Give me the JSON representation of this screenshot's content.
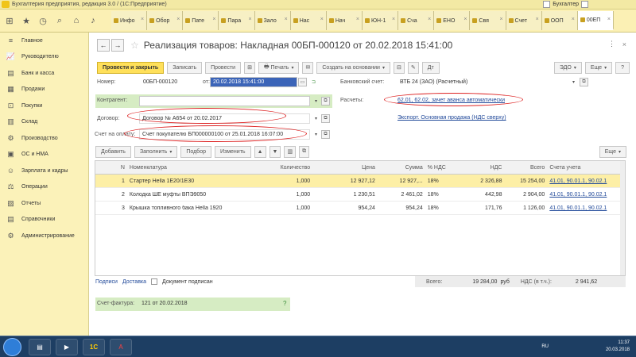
{
  "window": {
    "title": "Бухгалтерия предприятия, редакция 3.0 / (1С:Предприятие)",
    "user": "Бухгалтер"
  },
  "tabs": [
    "Инфо",
    "Обор",
    "Пате",
    "Пара",
    "Зало",
    "Нас",
    "Нач",
    "ЮН-1",
    "Сча",
    "ЕНО",
    "Свя",
    "Счет",
    "ООП",
    "00ЕП"
  ],
  "sidebar": {
    "items": [
      {
        "label": "Главное",
        "icon": "menu-icon"
      },
      {
        "label": "Руководителю",
        "icon": "chart-icon"
      },
      {
        "label": "Банк и касса",
        "icon": "bank-icon"
      },
      {
        "label": "Продажи",
        "icon": "sales-icon"
      },
      {
        "label": "Покупки",
        "icon": "cart-icon"
      },
      {
        "label": "Склад",
        "icon": "warehouse-icon"
      },
      {
        "label": "Производство",
        "icon": "factory-icon"
      },
      {
        "label": "ОС и НМА",
        "icon": "assets-icon"
      },
      {
        "label": "Зарплата и кадры",
        "icon": "staff-icon"
      },
      {
        "label": "Операции",
        "icon": "operations-icon"
      },
      {
        "label": "Отчеты",
        "icon": "reports-icon"
      },
      {
        "label": "Справочники",
        "icon": "reference-icon"
      },
      {
        "label": "Администрирование",
        "icon": "gear-icon"
      }
    ]
  },
  "doc": {
    "title": "Реализация товаров: Накладная 00БП-000120 от 20.02.2018 15:41:00"
  },
  "toolbar": {
    "post_close": "Провести и закрыть",
    "save": "Записать",
    "post": "Провести",
    "print": "Печать",
    "create_based": "Создать на основании",
    "dt_kt": "Дт",
    "edo": "ЭДО",
    "more": "Еще",
    "help": "?"
  },
  "form": {
    "number_label": "Номер:",
    "number_value": "00БП-000120",
    "date_label": "от:",
    "date_value": "20.02.2018 15:41:00",
    "bank_label": "Банковский счет:",
    "bank_value": "ВТБ 24 (ЗАО) (Расчетный)",
    "counterparty_label": "Контрагент:",
    "counterparty_value": "",
    "contract_label": "Договор:",
    "contract_value": "Договор № А654 от 20.02.2017",
    "payment_label": "Счет на оплату:",
    "payment_value": "Счет покупателю БП000000100 от 25.01.2018 16:07:00",
    "settlements_label": "Расчеты:",
    "settlements_value": "62.01, 62.02, зачет аванса автоматически",
    "vat_link": "Экспорт. Основная продажа (НДС сверху)"
  },
  "table": {
    "add": "Добавить",
    "fill": "Заполнить",
    "select": "Подбор",
    "change": "Изменить",
    "more": "Еще",
    "columns": [
      "N",
      "Номенклатура",
      "Количество",
      "Цена",
      "Сумма",
      "% НДС",
      "НДС",
      "Всего",
      "Счета учета"
    ],
    "rows": [
      {
        "n": "1",
        "name": "Стартер Hella 1Е20/1Е30",
        "qty": "1,000",
        "price": "12 927,12",
        "sum": "12 927,...",
        "vat_rate": "18%",
        "vat": "2 326,88",
        "total": "15 254,00",
        "accounts": "41.01, 90.01.1, 90.02.1"
      },
      {
        "n": "2",
        "name": "Колодка ШЕ муфты ВПЭ9050",
        "qty": "1,000",
        "price": "1 230,51",
        "sum": "2 461,02",
        "vat_rate": "18%",
        "vat": "442,98",
        "total": "2 904,00",
        "accounts": "41.01, 90.01.1, 90.02.1"
      },
      {
        "n": "3",
        "name": "Крышка топливного бака Hella 1920",
        "qty": "1,000",
        "price": "954,24",
        "sum": "954,24",
        "vat_rate": "18%",
        "vat": "171,76",
        "total": "1 126,00",
        "accounts": "41.01, 90.01.1, 90.02.1"
      }
    ]
  },
  "footer": {
    "tab_podpisi": "Подписи",
    "tab_dostavka": "Доставка",
    "doc_signed": "Документ подписан",
    "total_label": "Всего:",
    "total_value": "19 284,00",
    "currency": "руб",
    "vat_label": "НДС (в т.ч.):",
    "vat_value": "2 941,62",
    "invoice_label": "Счет-фактура:",
    "invoice_value": "121 от 20.02.2018"
  },
  "taskbar": {
    "lang": "RU",
    "time": "11:37",
    "date": "20.03.2018"
  }
}
